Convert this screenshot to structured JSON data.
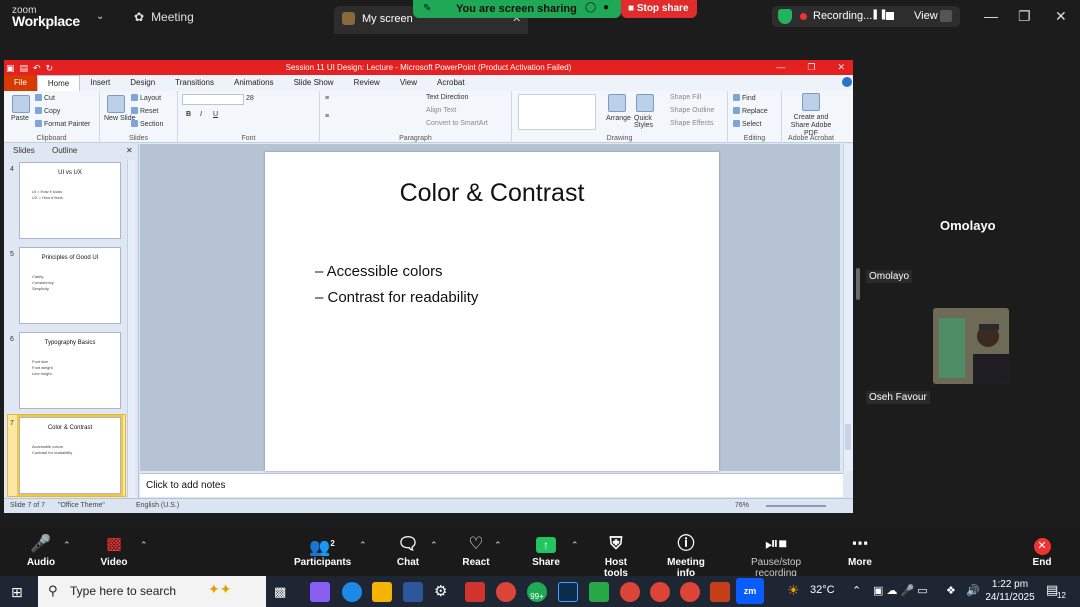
{
  "zoom": {
    "logo_line1": "zoom",
    "logo_line2": "Workplace",
    "meeting_label": "Meeting",
    "screen_tab_label": "My screen",
    "banner_text": "You are screen sharing",
    "stop_share_label": "Stop share",
    "recording_label": "Recording...",
    "view_label": "View",
    "colors": {
      "banner": "#1fa855",
      "stop": "#e02c2c",
      "recording_dot": "#e33333"
    }
  },
  "ppt": {
    "title": "Session 11 UI Design: Lecture  -  Microsoft PowerPoint (Product Activation Failed)",
    "tabs": [
      "File",
      "Home",
      "Insert",
      "Design",
      "Transitions",
      "Animations",
      "Slide Show",
      "Review",
      "View",
      "Acrobat"
    ],
    "ribbon": {
      "clipboard": {
        "paste": "Paste",
        "cut": "Cut",
        "copy": "Copy",
        "format_painter": "Format Painter",
        "group": "Clipboard"
      },
      "slides": {
        "new_slide": "New Slide",
        "layout": "Layout",
        "reset": "Reset",
        "section": "Section",
        "group": "Slides"
      },
      "font": {
        "size": "28",
        "group": "Font"
      },
      "paragraph": {
        "text_direction": "Text Direction",
        "align_text": "Align Text",
        "smartart": "Convert to SmartArt",
        "group": "Paragraph"
      },
      "drawing": {
        "arrange": "Arrange",
        "quick_styles": "Quick Styles",
        "shape_fill": "Shape Fill",
        "shape_outline": "Shape Outline",
        "shape_effects": "Shape Effects",
        "group": "Drawing"
      },
      "editing": {
        "find": "Find",
        "replace": "Replace",
        "select": "Select",
        "group": "Editing"
      },
      "acrobat": {
        "create_share": "Create and Share Adobe PDF",
        "group": "Adobe Acrobat"
      }
    },
    "panel_tabs": {
      "slides": "Slides",
      "outline": "Outline"
    },
    "thumbnails": [
      {
        "num": "4",
        "title": "UI vs UX",
        "bullets": [
          "UI = How it looks",
          "UX = How it feels"
        ]
      },
      {
        "num": "5",
        "title": "Principles of Good UI",
        "bullets": [
          "Clarity",
          "Consistency",
          "Simplicity"
        ]
      },
      {
        "num": "6",
        "title": "Typography Basics",
        "bullets": [
          "Font size",
          "Font weight",
          "Line height"
        ]
      },
      {
        "num": "7",
        "title": "Color & Contrast",
        "bullets": [
          "Accessible colors",
          "Contrast for readability"
        ]
      }
    ],
    "slide": {
      "title": "Color & Contrast",
      "bullets": [
        "– Accessible colors",
        "– Contrast for readability"
      ]
    },
    "notes_placeholder": "Click to add notes",
    "status": {
      "slide_count": "Slide 7 of 7",
      "theme": "\"Office Theme\"",
      "language": "English (U.S.)",
      "zoom": "76%"
    }
  },
  "participants": {
    "main_name": "Omolayo",
    "tile1": "Omolayo",
    "tile2": "Oseh Favour"
  },
  "toolbar": {
    "audio": "Audio",
    "video": "Video",
    "participants": "Participants",
    "participants_count": "2",
    "chat": "Chat",
    "react": "React",
    "share": "Share",
    "host_tools": "Host tools",
    "meeting_info": "Meeting info",
    "recording": "Pause/stop recording",
    "more": "More",
    "end": "End"
  },
  "taskbar": {
    "search_placeholder": "Type here to search",
    "badge": "99+",
    "weather": "32°C",
    "time": "1:22 pm",
    "date": "24/11/2025",
    "notifications": "12"
  }
}
